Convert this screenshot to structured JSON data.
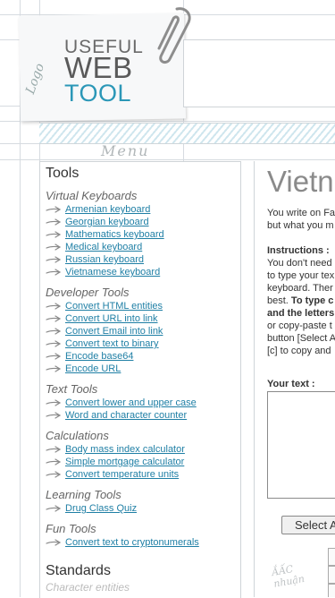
{
  "header": {
    "logo_useful": "USEFUL",
    "logo_web": "WEB",
    "logo_tool": "TOOL",
    "logo_hand": "Logo"
  },
  "menu_label": "Menu",
  "sidebar": {
    "heading": "Tools",
    "categories": [
      {
        "title": "Virtual Keyboards",
        "items": [
          "Armenian keyboard",
          "Georgian keyboard",
          "Mathematics keyboard",
          "Medical keyboard",
          "Russian keyboard",
          "Vietnamese keyboard"
        ]
      },
      {
        "title": "Developer Tools",
        "items": [
          "Convert HTML entities",
          "Convert URL into link",
          "Convert Email into link",
          "Convert text to binary",
          "Encode base64",
          "Encode URL"
        ]
      },
      {
        "title": "Text Tools",
        "items": [
          "Convert lower and upper case",
          "Word and character counter"
        ]
      },
      {
        "title": "Calculations",
        "items": [
          "Body mass index calculator",
          "Simple mortgage calculator",
          "Convert temperature units"
        ]
      },
      {
        "title": "Learning Tools",
        "items": [
          "Drug Class Quiz"
        ]
      },
      {
        "title": "Fun Tools",
        "items": [
          "Convert text to cryptonumerals"
        ]
      }
    ],
    "standards": "Standards",
    "standards_sub": "Character entities"
  },
  "main": {
    "title": "Vietn",
    "intro_1": "You write on Fa",
    "intro_2": "but what you m",
    "instructions_label": "Instructions :",
    "instr_1": "You don't need",
    "instr_2": "to type your tex",
    "instr_3": "keyboard. Ther",
    "instr_4": "best.",
    "instr_4b": " To type c",
    "instr_5": "and the letters",
    "instr_6": "or copy-paste t",
    "instr_7": "button [Select A",
    "instr_8": "[c] to copy and",
    "your_text_label": "Your text :",
    "select_button": "Select A",
    "sketch_1": "ẮẤC",
    "sketch_2": "nhuận"
  },
  "colors": {
    "accent": "#2b97b7",
    "link": "#1f7fa5"
  }
}
